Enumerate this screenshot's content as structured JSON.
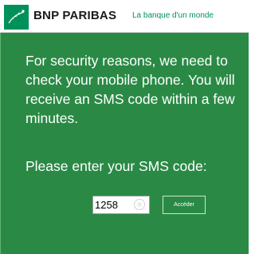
{
  "header": {
    "logo_icon": "bnp-star-logo-icon",
    "brand": "BNP PARIBAS",
    "tagline": "La banque d'un monde"
  },
  "main": {
    "message": "For security reasons, we need to check your mobile phone. You will receive an SMS code within a few minutes.",
    "prompt": "Please enter your SMS code:",
    "code_value": "1258",
    "clear_icon": "circle-clear-icon",
    "submit_label": "Accéder"
  },
  "colors": {
    "brand_green": "#00915a",
    "panel_green": "#2a8a45",
    "text_white": "#ffffff"
  }
}
